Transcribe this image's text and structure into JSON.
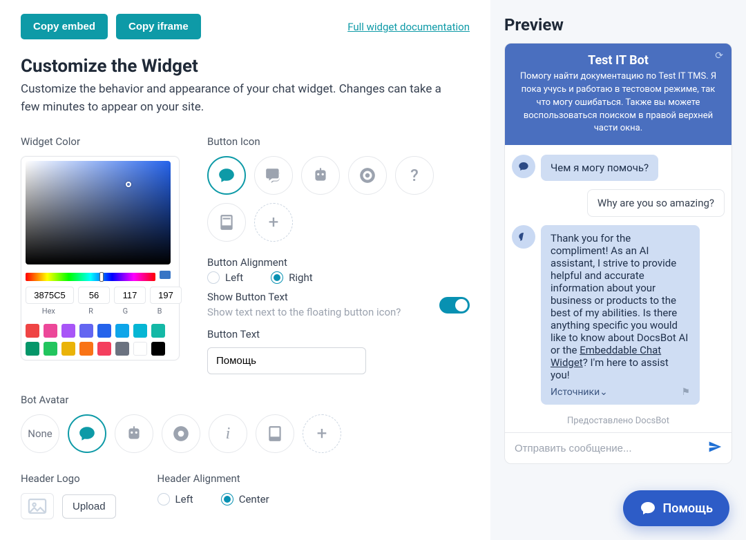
{
  "top": {
    "copy_embed": "Copy embed",
    "copy_iframe": "Copy iframe",
    "doc_link": "Full widget documentation"
  },
  "customize": {
    "title": "Customize the Widget",
    "subtitle": "Customize the behavior and appearance of your chat widget. Changes can take a few minutes to appear on your site."
  },
  "widget_color": {
    "label": "Widget Color",
    "hex": "3875C5",
    "r": "56",
    "g": "117",
    "b": "197",
    "hex_label": "Hex",
    "r_label": "R",
    "g_label": "G",
    "b_label": "B",
    "current_hex": "#3875C5",
    "swatches": [
      "#ef4444",
      "#ec4899",
      "#a855f7",
      "#6366f1",
      "#2563eb",
      "#0ea5e9",
      "#06b6d4",
      "#14b8a6",
      "#059669",
      "#22c55e",
      "#eab308",
      "#f97316",
      "#f43f5e",
      "#6b7280",
      "#ffffff",
      "#000000"
    ]
  },
  "button_icon": {
    "label": "Button Icon",
    "options": [
      "chat",
      "chats",
      "robot",
      "life-ring",
      "question",
      "book",
      "plus"
    ],
    "selected": "chat"
  },
  "button_alignment": {
    "label": "Button Alignment",
    "left": "Left",
    "right": "Right",
    "value": "right"
  },
  "show_button_text": {
    "label": "Show Button Text",
    "hint": "Show text next to the floating button icon?",
    "value": true
  },
  "button_text": {
    "label": "Button Text",
    "value": "Помощь"
  },
  "bot_avatar": {
    "label": "Bot Avatar",
    "none": "None",
    "options": [
      "none",
      "chat",
      "robot",
      "life-ring",
      "info",
      "book",
      "plus"
    ],
    "selected": "chat"
  },
  "header_logo": {
    "label": "Header Logo",
    "upload": "Upload"
  },
  "header_alignment": {
    "label": "Header Alignment",
    "left": "Left",
    "center": "Center",
    "value": "center"
  },
  "preview": {
    "title": "Preview",
    "bot_name": "Test IT Bot",
    "bot_desc": "Помогу найти документацию по Test IT TMS. Я пока учусь и работаю в тестовом режиме, так что могу ошибаться. Также вы можете воспользоваться поиском в правой верхней части окна.",
    "msg_greeting": "Чем я могу помочь?",
    "msg_user": "Why are you so amazing?",
    "msg_answer_pre": "Thank you for the compliment! As an AI assistant, I strive to provide helpful and accurate information about your business or products to the best of my abilities. Is there anything specific you would like to know about DocsBot AI or the ",
    "msg_answer_link": "Embeddable Chat Widget",
    "msg_answer_post": "? I'm here to assist you!",
    "sources": "Источники",
    "powered": "Предоставлено DocsBot",
    "input_placeholder": "Отправить сообщение...",
    "float_label": "Помощь"
  }
}
